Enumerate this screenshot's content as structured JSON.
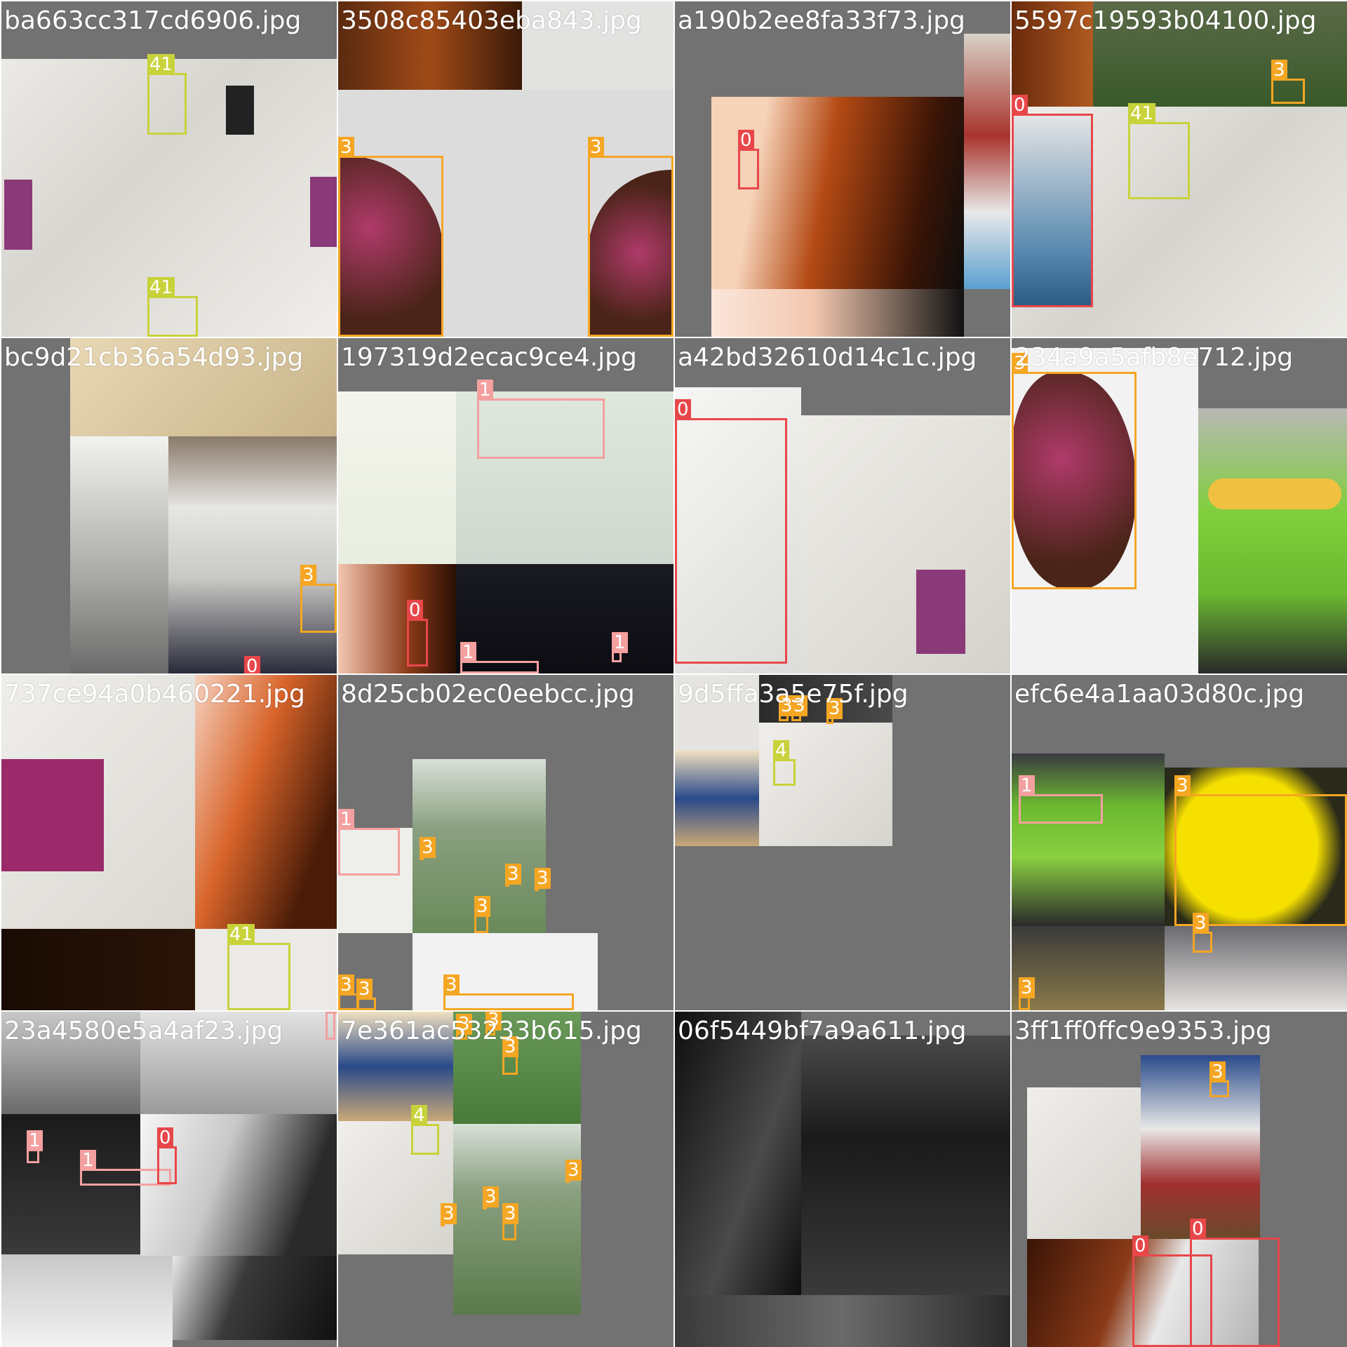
{
  "grid": {
    "rows": 4,
    "cols": 4,
    "background": "#727272",
    "separator": "#ffffff"
  },
  "class_colors": {
    "0": "#e8474a",
    "1": "#f4a0a0",
    "3": "#f5a623",
    "4": "#c8d23a",
    "41": "#c8d23a"
  },
  "tiles": [
    {
      "filename": "ba663cc317cd6906.jpg",
      "labels": [
        "41",
        "41"
      ]
    },
    {
      "filename": "3508c85403eba843.jpg",
      "labels": [
        "3",
        "3"
      ]
    },
    {
      "filename": "a190b2ee8fa33f73.jpg",
      "labels": [
        "0"
      ]
    },
    {
      "filename": "5597c19593b04100.jpg",
      "labels": [
        "3",
        "0",
        "41"
      ]
    },
    {
      "filename": "bc9d21cb36a54d93.jpg",
      "labels": [
        "3",
        "0"
      ]
    },
    {
      "filename": "197319d2ecac9ce4.jpg",
      "labels": [
        "1",
        "0",
        "1",
        "1"
      ]
    },
    {
      "filename": "a42bd32610d14c1c.jpg",
      "labels": [
        "0"
      ]
    },
    {
      "filename": "234a9a5afb8e712.jpg",
      "labels": [
        "3"
      ]
    },
    {
      "filename": "737ce94a0b460221.jpg",
      "labels": [
        "41"
      ]
    },
    {
      "filename": "8d25cb02ec0eebcc.jpg",
      "labels": [
        "1",
        "3",
        "3",
        "3",
        "3",
        "3",
        "3",
        "3"
      ]
    },
    {
      "filename": "9d5ffa3a5e75f.jpg",
      "labels": [
        "3",
        "3",
        "3",
        "4"
      ]
    },
    {
      "filename": "efc6e4a1aa03d80c.jpg",
      "labels": [
        "1",
        "3",
        "3",
        "3"
      ]
    },
    {
      "filename": "23a4580e5a4af23.jpg",
      "labels": [
        "1",
        "1",
        "0",
        "1"
      ]
    },
    {
      "filename": "7e361ac53233b615.jpg",
      "labels": [
        "3",
        "3",
        "3",
        "4",
        "3",
        "3",
        "3",
        "3"
      ]
    },
    {
      "filename": "06f5449bf7a9a611.jpg",
      "labels": []
    },
    {
      "filename": "3ff1ff0ffc9e9353.jpg",
      "labels": [
        "3",
        "0",
        "0"
      ]
    }
  ]
}
